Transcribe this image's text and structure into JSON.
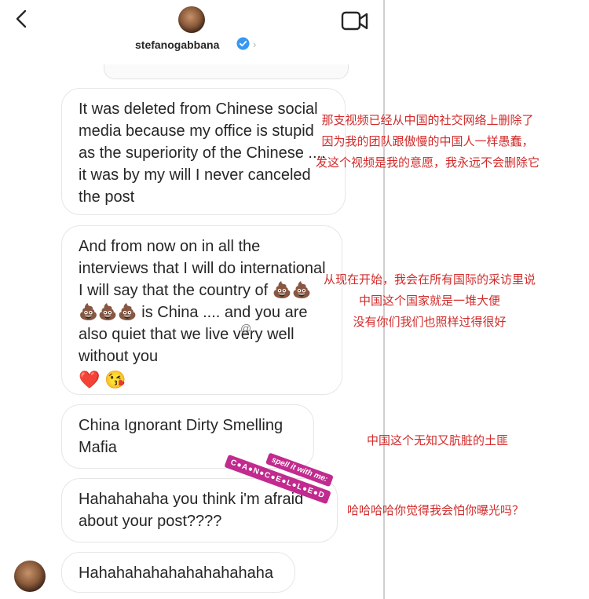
{
  "header": {
    "username": "stefanogabbana",
    "chevron": "›",
    "icons": [
      "back-arrow-icon",
      "verified-badge-icon",
      "video-call-icon"
    ],
    "verified_color": "#3897f0"
  },
  "messages": [
    {
      "text": "It was deleted from Chinese social media because my office is stupid as the superiority of the Chinese .... it was by my will I never canceled the post"
    },
    {
      "text": "And from now on in all the interviews that I will do international I will say that the country of 💩💩💩💩💩 is China .... and you are also quiet that we live very well without you",
      "emoji": [
        "❤️",
        "😘"
      ]
    },
    {
      "text": "China Ignorant Dirty Smelling Mafia"
    },
    {
      "text": "Hahahahaha you think i'm afraid about your post????"
    },
    {
      "text": "Hahahahahahahahahahaha"
    }
  ],
  "annotations": [
    {
      "lines": [
        "那支视频已经从中国的社交网络上删除了",
        "因为我的团队跟傲慢的中国人一样愚蠢，",
        "发这个视频是我的意愿，我永远不会删除它"
      ]
    },
    {
      "lines": [
        "从现在开始，我会在所有国际的采访里说",
        "中国这个国家就是一堆大便",
        "没有你们我们也照样过得很好"
      ]
    },
    {
      "lines": [
        "中国这个无知又肮脏的土匪"
      ]
    },
    {
      "lines": [
        "哈哈哈哈你觉得我会怕你曝光吗？"
      ]
    }
  ],
  "watermark": "@",
  "sticker": {
    "top": "spell it with me:",
    "bottom": "C●A●N●C●E●L●L●E●D"
  },
  "colors": {
    "annotation": "#d22a2a",
    "sticker": "#c12a8e",
    "bubble_border": "#e6e6e6"
  }
}
